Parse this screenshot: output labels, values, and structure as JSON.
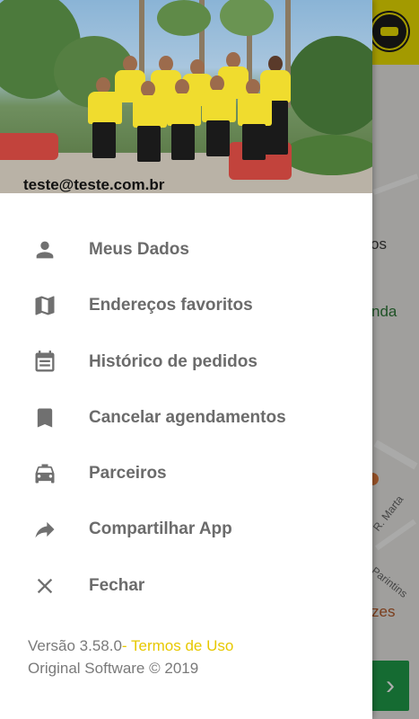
{
  "header": {
    "email": "teste@teste.com.br"
  },
  "menu": [
    {
      "label": "Meus Dados",
      "icon": "person-icon"
    },
    {
      "label": "Endereços favoritos",
      "icon": "map-icon"
    },
    {
      "label": "Histórico de pedidos",
      "icon": "calendar-icon"
    },
    {
      "label": "Cancelar agendamentos",
      "icon": "bookmark-icon"
    },
    {
      "label": "Parceiros",
      "icon": "taxi-icon"
    },
    {
      "label": "Compartilhar App",
      "icon": "share-arrow-icon"
    },
    {
      "label": "Fechar",
      "icon": "close-icon"
    }
  ],
  "footer": {
    "version": "Versão 3.58.0",
    "separator": "- ",
    "terms_link": "Termos de Uso",
    "copyright": "Original Software © 2019"
  },
  "background": {
    "text_1": "os",
    "text_2": "nda",
    "text_3": "zes",
    "street_1": "R. Marta",
    "street_2": "Parintins",
    "go_glyph": "›"
  },
  "colors": {
    "brand_yellow": "#f1e400",
    "menu_text": "#6b6b6b",
    "icon_gray": "#707070",
    "terms_link": "#e7c800",
    "go_button": "#1f9e4b"
  }
}
